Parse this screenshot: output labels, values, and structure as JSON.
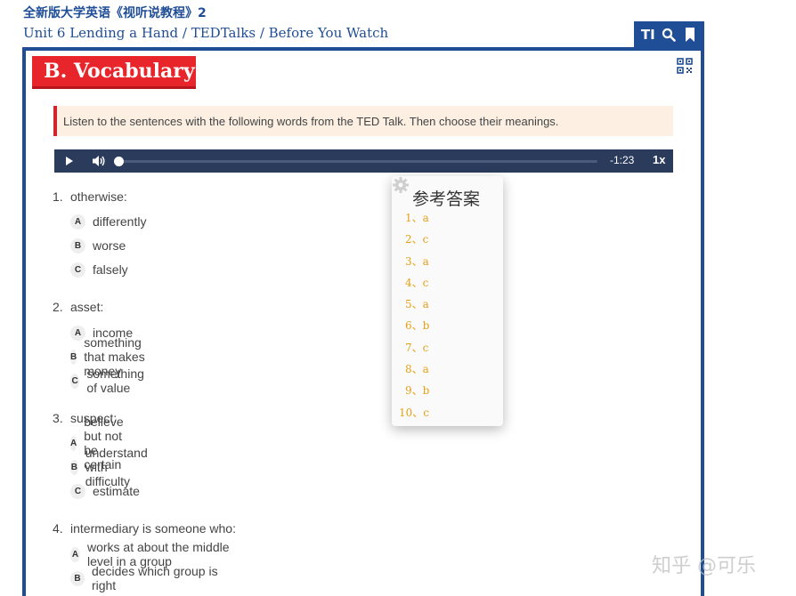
{
  "header": {
    "book_title": "全新版大学英语《视听说教程》2",
    "breadcrumb": "Unit 6 Lending a Hand / TEDTalks / Before You Watch"
  },
  "toolbar": {
    "font_icon_label": "TI",
    "icons": [
      "font-size-icon",
      "search-icon",
      "bookmark-icon"
    ]
  },
  "section": {
    "title": "B. Vocabulary",
    "instruction": "Listen to the sentences with the following words from the TED Talk. Then choose their meanings."
  },
  "audio": {
    "time": "-1:23",
    "speed": "1x",
    "progress": 0
  },
  "questions": [
    {
      "num": "1.",
      "prompt": "otherwise:",
      "options": [
        {
          "letter": "A",
          "text": "differently"
        },
        {
          "letter": "B",
          "text": "worse"
        },
        {
          "letter": "C",
          "text": "falsely"
        }
      ]
    },
    {
      "num": "2.",
      "prompt": "asset:",
      "options": [
        {
          "letter": "A",
          "text": "income"
        },
        {
          "letter": "B",
          "text": "something that makes money"
        },
        {
          "letter": "C",
          "text": "something of value"
        }
      ]
    },
    {
      "num": "3.",
      "prompt": "suspect:",
      "options": [
        {
          "letter": "A",
          "text": "believe but not be certain"
        },
        {
          "letter": "B",
          "text": "understand with difficulty"
        },
        {
          "letter": "C",
          "text": "estimate"
        }
      ]
    },
    {
      "num": "4.",
      "prompt": "intermediary is someone who:",
      "options": [
        {
          "letter": "A",
          "text": "works at about the middle level in a group"
        },
        {
          "letter": "B",
          "text": "decides which group is right"
        }
      ]
    }
  ],
  "answer_popup": {
    "title": "参考答案",
    "items": [
      "1、a",
      "2、c",
      "3、a",
      "4、c",
      "5、a",
      "6、b",
      "7、c",
      "8、a",
      "9、b",
      "10、c"
    ]
  },
  "watermark": "知乎 @可乐",
  "colors": {
    "brand_blue": "#1f4e96",
    "section_red": "#e8252b",
    "answer_orange": "#e6a117",
    "audio_bar": "#2b3b5c"
  }
}
